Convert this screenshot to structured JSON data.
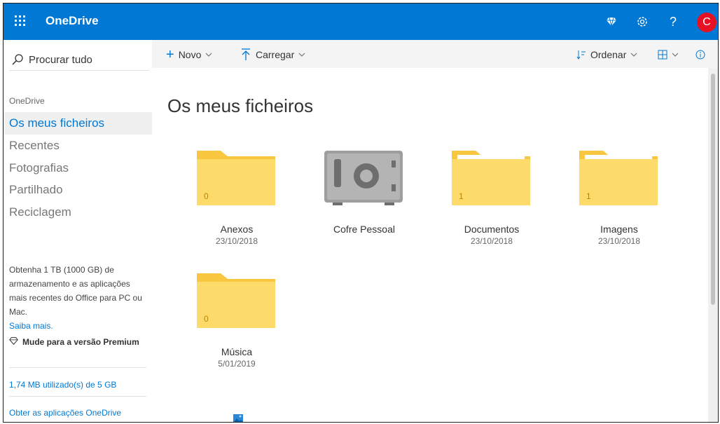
{
  "app": {
    "brand": "OneDrive",
    "accent": "#0078d4",
    "avatar_initial": "C"
  },
  "topbar": {
    "icons": [
      "waffle-icon",
      "diamond-icon",
      "settings-icon",
      "help-icon"
    ]
  },
  "sidebar": {
    "search_placeholder": "Procurar tudo",
    "section_title": "OneDrive",
    "items": [
      {
        "label": "Os meus ficheiros",
        "active": true
      },
      {
        "label": "Recentes",
        "active": false
      },
      {
        "label": "Fotografias",
        "active": false
      },
      {
        "label": "Partilhado",
        "active": false
      },
      {
        "label": "Reciclagem",
        "active": false
      }
    ],
    "promo_text": "Obtenha 1 TB (1000 GB) de armazenamento e as aplicações mais recentes do Office para PC ou Mac.",
    "promo_link": "Saiba mais.",
    "premium_label": "Mude para a versão Premium",
    "usage": "1,74 MB utilizado(s) de 5 GB",
    "get_apps": "Obter as aplicações OneDrive"
  },
  "commands": {
    "new_label": "Novo",
    "upload_label": "Carregar",
    "sort_label": "Ordenar"
  },
  "main": {
    "title": "Os meus ficheiros",
    "items": [
      {
        "name": "Anexos",
        "date": "23/10/2018",
        "type": "folder",
        "count": "0"
      },
      {
        "name": "Cofre Pessoal",
        "date": "",
        "type": "vault",
        "count": ""
      },
      {
        "name": "Documentos",
        "date": "23/10/2018",
        "type": "folder",
        "count": "1"
      },
      {
        "name": "Imagens",
        "date": "23/10/2018",
        "type": "folder",
        "count": "1"
      },
      {
        "name": "Música",
        "date": "5/01/2019",
        "type": "folder",
        "count": "0"
      }
    ]
  }
}
